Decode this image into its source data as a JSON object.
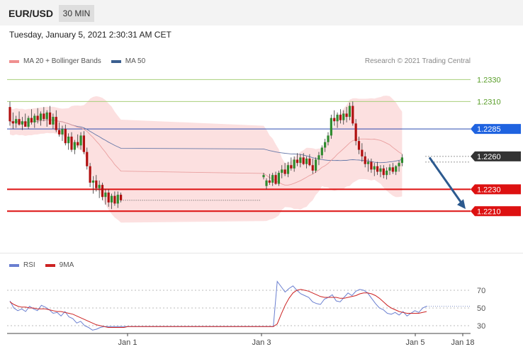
{
  "header": {
    "symbol": "EUR/USD",
    "timeframe": "30 MIN"
  },
  "datetime": "Tuesday, January 5, 2021 2:30:31 AM CET",
  "credit": "Research © 2021 Trading Central",
  "legend": {
    "price": [
      {
        "label": "MA 20 + Bollinger Bands",
        "color": "#ef8f8f"
      },
      {
        "label": "MA 50",
        "color": "#3a5f8f"
      }
    ],
    "rsi": [
      {
        "label": "RSI",
        "color": "#6a7fd0"
      },
      {
        "label": "9MA",
        "color": "#cc2222"
      }
    ]
  },
  "chart_data": [
    {
      "type": "candlestick",
      "ylim": [
        1.2196,
        1.2338
      ],
      "x_ticks": [
        "Jan 1",
        "Jan 3",
        "Jan 5",
        "Jan 18"
      ],
      "levels": [
        {
          "value": 1.233,
          "label": "1.2330",
          "color": "#a8cf7a",
          "label_color": "#5a9e2a",
          "box": false
        },
        {
          "value": 1.231,
          "label": "1.2310",
          "color": "#a8cf7a",
          "label_color": "#5a9e2a",
          "box": false
        },
        {
          "value": 1.2285,
          "label": "1.2285",
          "color": "#2c4bb0",
          "label_color": "#ffffff",
          "box": true,
          "box_color": "#1f63e0"
        },
        {
          "value": 1.226,
          "label": "1.2260",
          "color": "#999999",
          "label_color": "#ffffff",
          "box": true,
          "box_color": "#333333",
          "dotted": true
        },
        {
          "value": 1.223,
          "label": "1.2230",
          "color": "#dd1111",
          "label_color": "#ffffff",
          "box": true,
          "box_color": "#dd1111"
        },
        {
          "value": 1.221,
          "label": "1.2210",
          "color": "#dd1111",
          "label_color": "#ffffff",
          "box": true,
          "box_color": "#dd1111"
        }
      ],
      "forecast_arrow": {
        "from": 1.2259,
        "to": 1.2212,
        "color": "#2c5a8f"
      },
      "candles": [
        [
          1.2305,
          1.231,
          1.2288,
          1.2292
        ],
        [
          1.2292,
          1.23,
          1.2285,
          1.229
        ],
        [
          1.229,
          1.2297,
          1.2286,
          1.2294
        ],
        [
          1.2294,
          1.2301,
          1.2288,
          1.2289
        ],
        [
          1.2289,
          1.2296,
          1.2284,
          1.2292
        ],
        [
          1.2292,
          1.2299,
          1.2287,
          1.2287
        ],
        [
          1.2287,
          1.2297,
          1.2285,
          1.2295
        ],
        [
          1.2295,
          1.2303,
          1.2289,
          1.2291
        ],
        [
          1.2291,
          1.2299,
          1.2286,
          1.2297
        ],
        [
          1.2297,
          1.2304,
          1.229,
          1.2293
        ],
        [
          1.2293,
          1.2301,
          1.2288,
          1.2299
        ],
        [
          1.2299,
          1.2305,
          1.2292,
          1.2294
        ],
        [
          1.2294,
          1.2302,
          1.2287,
          1.23
        ],
        [
          1.23,
          1.2306,
          1.229,
          1.2289
        ],
        [
          1.2289,
          1.2299,
          1.2285,
          1.2296
        ],
        [
          1.2296,
          1.2302,
          1.2282,
          1.2284
        ],
        [
          1.2284,
          1.2291,
          1.2278,
          1.228
        ],
        [
          1.228,
          1.2288,
          1.2274,
          1.2285
        ],
        [
          1.2285,
          1.2289,
          1.227,
          1.2272
        ],
        [
          1.2272,
          1.2281,
          1.2266,
          1.2278
        ],
        [
          1.2278,
          1.2282,
          1.2264,
          1.2266
        ],
        [
          1.2266,
          1.2275,
          1.2262,
          1.2273
        ],
        [
          1.2273,
          1.228,
          1.2268,
          1.227
        ],
        [
          1.227,
          1.2282,
          1.2266,
          1.2279
        ],
        [
          1.2279,
          1.2283,
          1.2262,
          1.2264
        ],
        [
          1.2264,
          1.2268,
          1.2248,
          1.2251
        ],
        [
          1.2251,
          1.2254,
          1.2232,
          1.2236
        ],
        [
          1.2236,
          1.2242,
          1.2226,
          1.2238
        ],
        [
          1.2238,
          1.2243,
          1.2228,
          1.2231
        ],
        [
          1.2231,
          1.2238,
          1.2222,
          1.2234
        ],
        [
          1.2234,
          1.2236,
          1.222,
          1.2223
        ],
        [
          1.2223,
          1.223,
          1.2216,
          1.2227
        ],
        [
          1.2227,
          1.223,
          1.2214,
          1.2218
        ],
        [
          1.2218,
          1.2226,
          1.2212,
          1.2224
        ],
        [
          1.2224,
          1.2228,
          1.2215,
          1.2217
        ],
        [
          1.2217,
          1.2228,
          1.2213,
          1.2225
        ],
        [
          1.2225,
          1.2227,
          1.2218,
          1.222
        ],
        [
          1.2241,
          1.2245,
          1.2239,
          1.2243
        ],
        [
          1.2233,
          1.224,
          1.223,
          1.2238
        ],
        [
          1.2238,
          1.2244,
          1.2234,
          1.2236
        ],
        [
          1.2236,
          1.2245,
          1.2233,
          1.2243
        ],
        [
          1.2243,
          1.2246,
          1.2234,
          1.2235
        ],
        [
          1.2235,
          1.2247,
          1.2233,
          1.2245
        ],
        [
          1.2245,
          1.2252,
          1.224,
          1.2248
        ],
        [
          1.2248,
          1.2254,
          1.2242,
          1.2244
        ],
        [
          1.2244,
          1.2255,
          1.2241,
          1.2252
        ],
        [
          1.2252,
          1.2259,
          1.2247,
          1.2249
        ],
        [
          1.2249,
          1.226,
          1.2246,
          1.2257
        ],
        [
          1.2257,
          1.2263,
          1.2251,
          1.2254
        ],
        [
          1.2254,
          1.2262,
          1.225,
          1.2259
        ],
        [
          1.2259,
          1.2263,
          1.2252,
          1.2253
        ],
        [
          1.2253,
          1.226,
          1.2249,
          1.2258
        ],
        [
          1.2258,
          1.2262,
          1.2251,
          1.2252
        ],
        [
          1.2252,
          1.2258,
          1.2244,
          1.2247
        ],
        [
          1.2247,
          1.2259,
          1.2245,
          1.2257
        ],
        [
          1.2257,
          1.2264,
          1.2252,
          1.2261
        ],
        [
          1.2261,
          1.227,
          1.2258,
          1.2268
        ],
        [
          1.2268,
          1.2276,
          1.2264,
          1.2273
        ],
        [
          1.2273,
          1.2282,
          1.227,
          1.2279
        ],
        [
          1.2279,
          1.2298,
          1.2276,
          1.2295
        ],
        [
          1.2295,
          1.2302,
          1.2288,
          1.2292
        ],
        [
          1.2292,
          1.23,
          1.2286,
          1.2298
        ],
        [
          1.2298,
          1.2303,
          1.229,
          1.2293
        ],
        [
          1.2293,
          1.2302,
          1.2289,
          1.2299
        ],
        [
          1.2299,
          1.2305,
          1.2291,
          1.2296
        ],
        [
          1.2296,
          1.2309,
          1.2293,
          1.2306
        ],
        [
          1.2306,
          1.231,
          1.2288,
          1.229
        ],
        [
          1.229,
          1.2294,
          1.227,
          1.2274
        ],
        [
          1.2274,
          1.2278,
          1.2262,
          1.2266
        ],
        [
          1.2266,
          1.2272,
          1.2255,
          1.226
        ],
        [
          1.226,
          1.2264,
          1.225,
          1.2253
        ],
        [
          1.2253,
          1.2258,
          1.2246,
          1.2255
        ],
        [
          1.2255,
          1.2258,
          1.2245,
          1.2248
        ],
        [
          1.2248,
          1.2254,
          1.2242,
          1.2251
        ],
        [
          1.2251,
          1.2255,
          1.2243,
          1.2246
        ],
        [
          1.2246,
          1.2252,
          1.2241,
          1.2249
        ],
        [
          1.2249,
          1.2252,
          1.224,
          1.2243
        ],
        [
          1.2243,
          1.225,
          1.2239,
          1.2247
        ],
        [
          1.2247,
          1.2253,
          1.2243,
          1.225
        ],
        [
          1.225,
          1.2254,
          1.2244,
          1.2246
        ],
        [
          1.2246,
          1.2252,
          1.2243,
          1.2251
        ],
        [
          1.2251,
          1.2256,
          1.2246,
          1.2254
        ],
        [
          1.2254,
          1.2262,
          1.2251,
          1.2259
        ]
      ]
    },
    {
      "type": "line",
      "ylim": [
        22,
        82
      ],
      "y_ticks": [
        "70",
        "50",
        "30"
      ],
      "series": [
        {
          "name": "RSI",
          "color": "#6a7fd0",
          "values": [
            58,
            50,
            47,
            49,
            46,
            52,
            49,
            47,
            53,
            51,
            48,
            44,
            45,
            41,
            46,
            40,
            38,
            33,
            35,
            30,
            28,
            25,
            26,
            28,
            29,
            29,
            29,
            29,
            29,
            29,
            29,
            29,
            29,
            29,
            29,
            29,
            29,
            29,
            29,
            29,
            29,
            29,
            29,
            29,
            29,
            29,
            29,
            29,
            29,
            29,
            29,
            29,
            29,
            29,
            29,
            29,
            29,
            29,
            29,
            29,
            29,
            29,
            29,
            29,
            29,
            29,
            29,
            29,
            80,
            74,
            68,
            72,
            75,
            70,
            66,
            64,
            62,
            57,
            55,
            54,
            60,
            62,
            65,
            58,
            57,
            62,
            67,
            64,
            69,
            71,
            70,
            67,
            61,
            55,
            50,
            48,
            44,
            43,
            45,
            42,
            46,
            41,
            44,
            47,
            45,
            50,
            52
          ]
        },
        {
          "name": "9MA",
          "color": "#cc2222",
          "values": [
            57,
            54,
            52,
            51,
            51,
            50,
            50,
            49,
            49,
            49,
            48,
            47,
            46,
            46,
            45,
            44,
            43,
            41,
            39,
            37,
            35,
            33,
            31,
            30,
            29,
            28,
            28,
            28,
            28,
            28,
            29,
            29,
            29,
            29,
            29,
            29,
            29,
            29,
            29,
            29,
            29,
            29,
            29,
            29,
            29,
            29,
            29,
            29,
            29,
            29,
            29,
            29,
            29,
            29,
            29,
            29,
            29,
            29,
            29,
            29,
            29,
            29,
            29,
            29,
            29,
            29,
            29,
            29,
            32,
            43,
            53,
            61,
            67,
            70,
            71,
            70,
            69,
            67,
            65,
            63,
            62,
            62,
            62,
            62,
            61,
            61,
            62,
            63,
            64,
            66,
            67,
            67,
            66,
            64,
            61,
            57,
            53,
            50,
            48,
            46,
            45,
            44,
            44,
            44,
            44,
            45,
            46
          ]
        }
      ]
    }
  ]
}
